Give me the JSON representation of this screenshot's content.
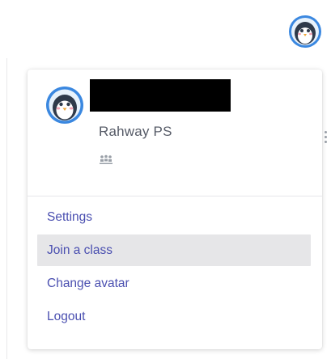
{
  "header": {
    "avatar_icon": "penguin-avatar-icon"
  },
  "profile": {
    "avatar_icon": "penguin-avatar-icon",
    "name": "",
    "school": "Rahway PS",
    "class_icon": "classroom-people-icon"
  },
  "menu": {
    "items": [
      {
        "label": "Settings"
      },
      {
        "label": "Join a class"
      },
      {
        "label": "Change avatar"
      },
      {
        "label": "Logout"
      }
    ],
    "highlighted_index": 1
  },
  "colors": {
    "menu_text": "#4a4fb0",
    "highlight_bg": "#e6e6e8",
    "avatar_ring": "#3b88e0",
    "secondary_text": "#555a66"
  }
}
